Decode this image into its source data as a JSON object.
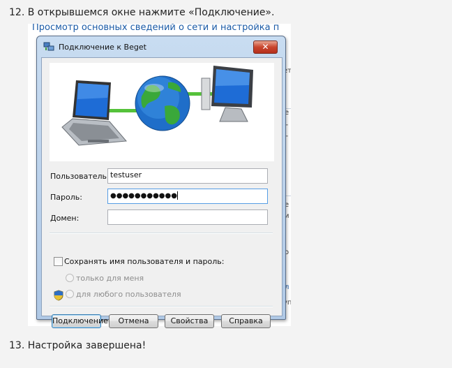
{
  "steps": {
    "step12": "12. В открывшемся окне нажмите «Подключение».",
    "step13": "13. Настройка завершена!"
  },
  "background": {
    "heading_link": "Просмотр основных сведений о сети и настройка п",
    "fragments": [
      "ет",
      "е",
      "г",
      "г",
      "е",
      "и",
      "о",
      "л",
      "уп"
    ]
  },
  "dialog": {
    "title": "Подключение к Beget",
    "close_glyph": "✕",
    "icon": "network-connection-icon",
    "banner_icons": [
      "laptop-icon",
      "globe-icon",
      "desktop-monitor-icon"
    ],
    "fields": {
      "username_label": "Пользователь:",
      "username_value": "testuser",
      "password_label": "Пароль:",
      "password_value": "●●●●●●●●●●●",
      "domain_label": "Домен:",
      "domain_value": ""
    },
    "save_credentials": {
      "label": "Сохранять имя пользователя и пароль:",
      "checked": false,
      "options": [
        "только для меня",
        "для любого пользователя"
      ]
    },
    "buttons": {
      "connect": "Подключение",
      "cancel": "Отмена",
      "properties": "Свойства",
      "help": "Справка"
    }
  }
}
